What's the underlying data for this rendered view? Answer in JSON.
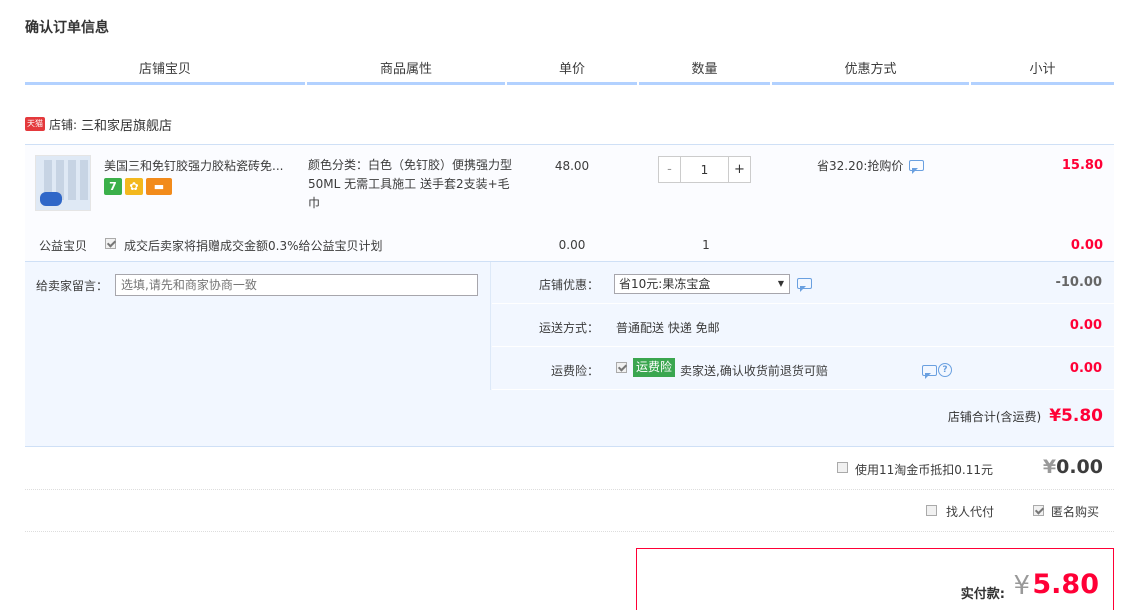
{
  "page": {
    "title": "确认订单信息"
  },
  "columns": [
    "店铺宝贝",
    "商品属性",
    "单价",
    "数量",
    "优惠方式",
    "小计"
  ],
  "shop": {
    "badge": "天猫",
    "label": "店铺:",
    "name": "三和家居旗舰店"
  },
  "item": {
    "title": "美国三和免钉胶强力胶粘瓷砖免...",
    "service_icons": [
      "7",
      "✿",
      "▬"
    ],
    "attributes": "颜色分类：白色（免钉胶）便携强力型 50ML 无需工具施工 送手套2支装+毛巾",
    "price": "48.00",
    "quantity": "1",
    "qty_minus": "-",
    "qty_plus": "+",
    "promo": "省32.20:抢购价",
    "subtotal": "15.80"
  },
  "charity": {
    "label": "公益宝贝",
    "checked": true,
    "desc": "成交后卖家将捐赠成交金额0.3%给公益宝贝计划",
    "price": "0.00",
    "quantity": "1",
    "subtotal": "0.00"
  },
  "message": {
    "label": "给卖家留言：",
    "placeholder": "选填,请先和商家协商一致"
  },
  "shop_coupon": {
    "label": "店铺优惠：",
    "selected": "省10元:果冻宝盒",
    "amount": "-10.00"
  },
  "shipping": {
    "label": "运送方式：",
    "value": "普通配送 快递 免邮",
    "amount": "0.00"
  },
  "insurance": {
    "label": "运费险：",
    "badge": "运费险",
    "desc": "卖家送,确认收货前退货可赔",
    "help": "?",
    "amount": "0.00"
  },
  "shop_total": {
    "label": "店铺合计(含运费)",
    "amount": "¥5.80"
  },
  "coins": {
    "label": "使用11淘金币抵扣0.11元",
    "yen": "¥",
    "amount": "0.00"
  },
  "extras": {
    "proxy_label": "找人代付",
    "anonymous_label": "匿名购买"
  },
  "payment": {
    "label": "实付款:",
    "yen": "¥",
    "amount": "5.80"
  },
  "colors": {
    "accent": "#ff0036",
    "header_border": "#b2d1ff",
    "panel_bg": "#f2f7ff",
    "badge_green": "#3aa64f"
  }
}
